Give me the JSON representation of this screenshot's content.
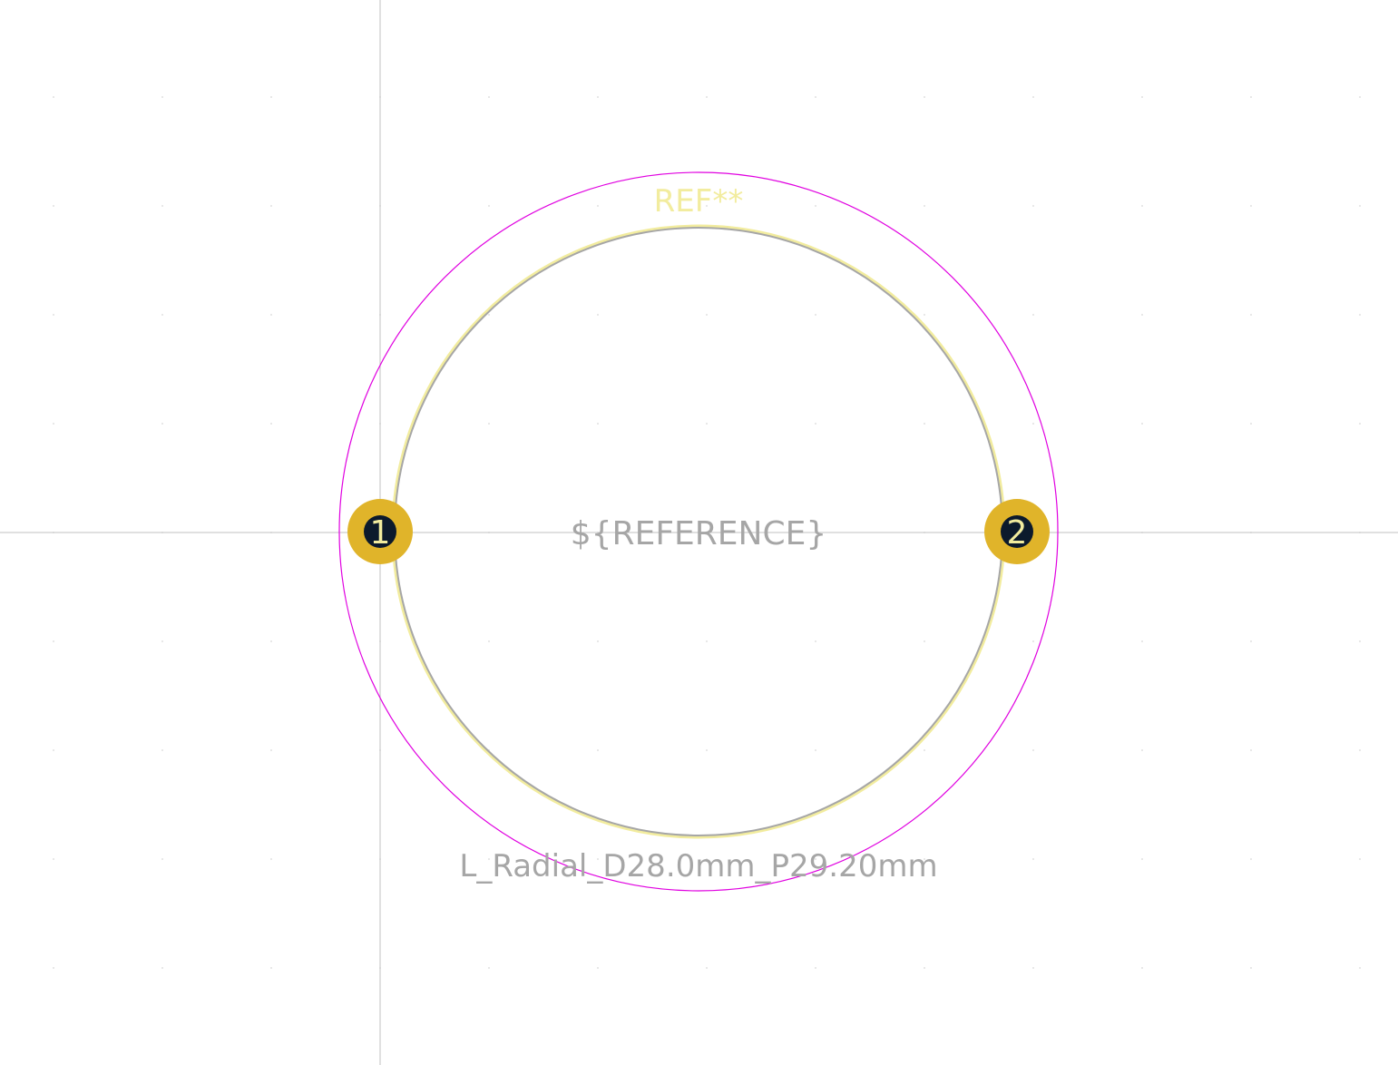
{
  "footprint": {
    "reference_label": "REF**",
    "reference_field": "${REFERENCE}",
    "value_label": "L_Radial_D28.0mm_P29.20mm"
  },
  "pads": [
    {
      "number": "1"
    },
    {
      "number": "2"
    }
  ],
  "colors": {
    "background": "#ffffff",
    "grid_dot": "#d8d8d8",
    "crosshair": "#c0c0c0",
    "courtyard": "#e000e0",
    "silkscreen": "#f2ec9e",
    "fab_outline": "#a6a6a6",
    "pad": "#e0b42a",
    "drill_hole": "#0c1a2c",
    "pad_number": "#f2ec9e",
    "fab_text": "#a6a6a6"
  }
}
